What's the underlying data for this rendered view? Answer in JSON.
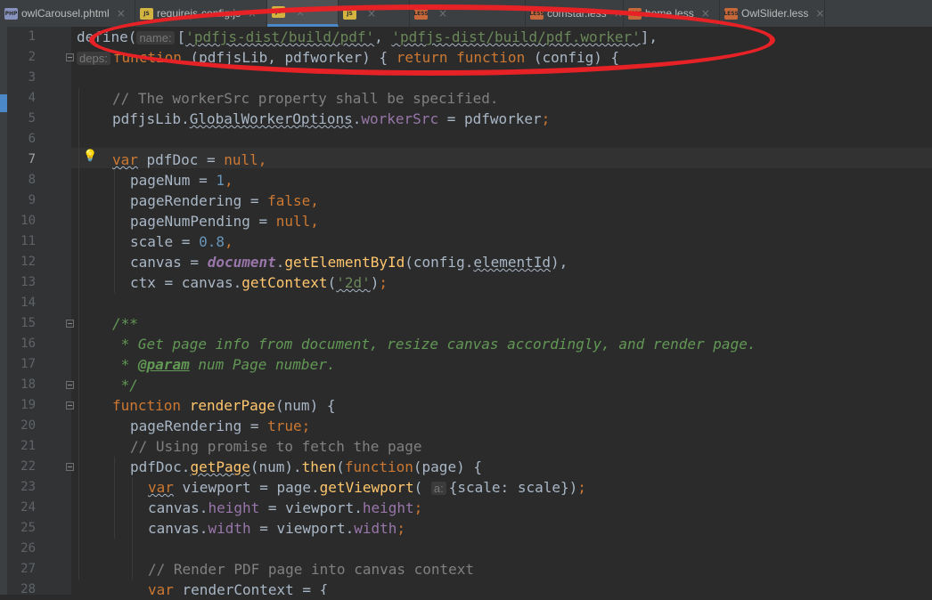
{
  "tabs": [
    {
      "label": "owlCarousel.phtml",
      "icon": "php-file-icon",
      "badge": "PHP",
      "color": "#8892bf"
    },
    {
      "label": "requirejs-config.js",
      "icon": "js-file-icon",
      "badge": "JS",
      "color": "#d4b441"
    },
    {
      "label": "",
      "icon": "js-file-icon",
      "badge": "JS",
      "color": "#d4b441",
      "active": true
    },
    {
      "label": "",
      "icon": "js-file-icon",
      "badge": "JS",
      "color": "#d4b441"
    },
    {
      "label": "",
      "icon": "less-file-icon",
      "badge": "LESS",
      "color": "#c7683a"
    },
    {
      "label": "comstar.less",
      "icon": "less-file-icon",
      "badge": "LESS",
      "color": "#c7683a"
    },
    {
      "label": "home.less",
      "icon": "less-file-icon",
      "badge": "LESS",
      "color": "#c7683a"
    },
    {
      "label": "OwlSlider.less",
      "icon": "less-file-icon",
      "badge": "LESS",
      "color": "#c7683a"
    }
  ],
  "editor": {
    "current_line": 7,
    "lines": [
      {
        "n": 1,
        "indent": 0,
        "tokens": [
          [
            "t",
            "define("
          ],
          [
            "hint",
            "name:"
          ],
          [
            "t",
            "["
          ],
          [
            "s",
            "'pdfjs-dist/build/pdf'"
          ],
          [
            "t",
            ", "
          ],
          [
            "s",
            "'pdfjs-dist/build/pdf.worker'"
          ],
          [
            "t",
            "],"
          ]
        ]
      },
      {
        "n": 2,
        "indent": 0,
        "tokens": [
          [
            "hint",
            "deps:"
          ],
          [
            "k",
            "function "
          ],
          [
            "t",
            "(pdfjsLib, pdfworker) { "
          ],
          [
            "k",
            "return function "
          ],
          [
            "t",
            "(config) {"
          ]
        ]
      },
      {
        "n": 3,
        "indent": 0,
        "tokens": []
      },
      {
        "n": 4,
        "indent": 2,
        "tokens": [
          [
            "c",
            "// The workerSrc property shall be specified."
          ]
        ]
      },
      {
        "n": 5,
        "indent": 2,
        "tokens": [
          [
            "t",
            "pdfjsLib."
          ],
          [
            "sq",
            "GlobalWorkerOptions"
          ],
          [
            "t",
            "."
          ],
          [
            "pr",
            "workerSrc"
          ],
          [
            "t",
            " = pdfworker"
          ],
          [
            "k",
            ";"
          ]
        ]
      },
      {
        "n": 6,
        "indent": 0,
        "tokens": []
      },
      {
        "n": 7,
        "indent": 2,
        "tokens": [
          [
            "ksq",
            "var"
          ],
          [
            "t",
            " pdfDoc = "
          ],
          [
            "k",
            "null,"
          ]
        ]
      },
      {
        "n": 8,
        "indent": 3,
        "tokens": [
          [
            "t",
            "pageNum = "
          ],
          [
            "n",
            "1"
          ],
          [
            "k",
            ","
          ]
        ]
      },
      {
        "n": 9,
        "indent": 3,
        "tokens": [
          [
            "t",
            "pageRendering = "
          ],
          [
            "k",
            "false,"
          ]
        ]
      },
      {
        "n": 10,
        "indent": 3,
        "tokens": [
          [
            "t",
            "pageNumPending = "
          ],
          [
            "k",
            "null,"
          ]
        ]
      },
      {
        "n": 11,
        "indent": 3,
        "tokens": [
          [
            "t",
            "scale = "
          ],
          [
            "n",
            "0.8"
          ],
          [
            "k",
            ","
          ]
        ]
      },
      {
        "n": 12,
        "indent": 3,
        "tokens": [
          [
            "t",
            "canvas = "
          ],
          [
            "gl",
            "document"
          ],
          [
            "t",
            "."
          ],
          [
            "fn",
            "getElementById"
          ],
          [
            "t",
            "(config."
          ],
          [
            "sq",
            "elementId"
          ],
          [
            "t",
            "),"
          ]
        ]
      },
      {
        "n": 13,
        "indent": 3,
        "tokens": [
          [
            "t",
            "ctx = canvas."
          ],
          [
            "fn",
            "getContext"
          ],
          [
            "t",
            "("
          ],
          [
            "s",
            "'2d'"
          ],
          [
            "t",
            ")"
          ],
          [
            "k",
            ";"
          ]
        ]
      },
      {
        "n": 14,
        "indent": 0,
        "tokens": []
      },
      {
        "n": 15,
        "indent": 2,
        "tokens": [
          [
            "d",
            "/**"
          ]
        ]
      },
      {
        "n": 16,
        "indent": 2,
        "tokens": [
          [
            "d",
            " * Get page info from document, resize canvas accordingly, and render page."
          ]
        ]
      },
      {
        "n": 17,
        "indent": 2,
        "tokens": [
          [
            "d",
            " * "
          ],
          [
            "dt",
            "@param"
          ],
          [
            "d",
            " num Page number."
          ]
        ]
      },
      {
        "n": 18,
        "indent": 2,
        "tokens": [
          [
            "d",
            " */"
          ]
        ]
      },
      {
        "n": 19,
        "indent": 2,
        "tokens": [
          [
            "k",
            "function "
          ],
          [
            "fn",
            "renderPage"
          ],
          [
            "t",
            "(num) {"
          ]
        ]
      },
      {
        "n": 20,
        "indent": 3,
        "tokens": [
          [
            "t",
            "pageRendering = "
          ],
          [
            "k",
            "true;"
          ]
        ]
      },
      {
        "n": 21,
        "indent": 3,
        "tokens": [
          [
            "c",
            "// Using promise to fetch the page"
          ]
        ]
      },
      {
        "n": 22,
        "indent": 3,
        "tokens": [
          [
            "t",
            "pdfDoc."
          ],
          [
            "fnsq",
            "getPage"
          ],
          [
            "t",
            "(num)."
          ],
          [
            "fn",
            "then"
          ],
          [
            "t",
            "("
          ],
          [
            "k",
            "function"
          ],
          [
            "t",
            "(page) {"
          ]
        ]
      },
      {
        "n": 23,
        "indent": 4,
        "tokens": [
          [
            "ksq",
            "var"
          ],
          [
            "t",
            " viewport = page."
          ],
          [
            "fn",
            "getViewport"
          ],
          [
            "t",
            "( "
          ],
          [
            "hint",
            "a:"
          ],
          [
            "t",
            "{scale: scale})"
          ],
          [
            "k",
            ";"
          ]
        ]
      },
      {
        "n": 24,
        "indent": 4,
        "tokens": [
          [
            "t",
            "canvas."
          ],
          [
            "pr",
            "height"
          ],
          [
            "t",
            " = viewport."
          ],
          [
            "pr",
            "height"
          ],
          [
            "k",
            ";"
          ]
        ]
      },
      {
        "n": 25,
        "indent": 4,
        "tokens": [
          [
            "t",
            "canvas."
          ],
          [
            "pr",
            "width"
          ],
          [
            "t",
            " = viewport."
          ],
          [
            "pr",
            "width"
          ],
          [
            "k",
            ";"
          ]
        ]
      },
      {
        "n": 26,
        "indent": 0,
        "tokens": []
      },
      {
        "n": 27,
        "indent": 4,
        "tokens": [
          [
            "c",
            "// Render PDF page into canvas context"
          ]
        ]
      },
      {
        "n": 28,
        "indent": 4,
        "tokens": [
          [
            "k",
            "var"
          ],
          [
            "t",
            " renderContext = {"
          ]
        ]
      }
    ]
  },
  "annotation": {
    "shape": "oval",
    "color": "#e62226"
  }
}
